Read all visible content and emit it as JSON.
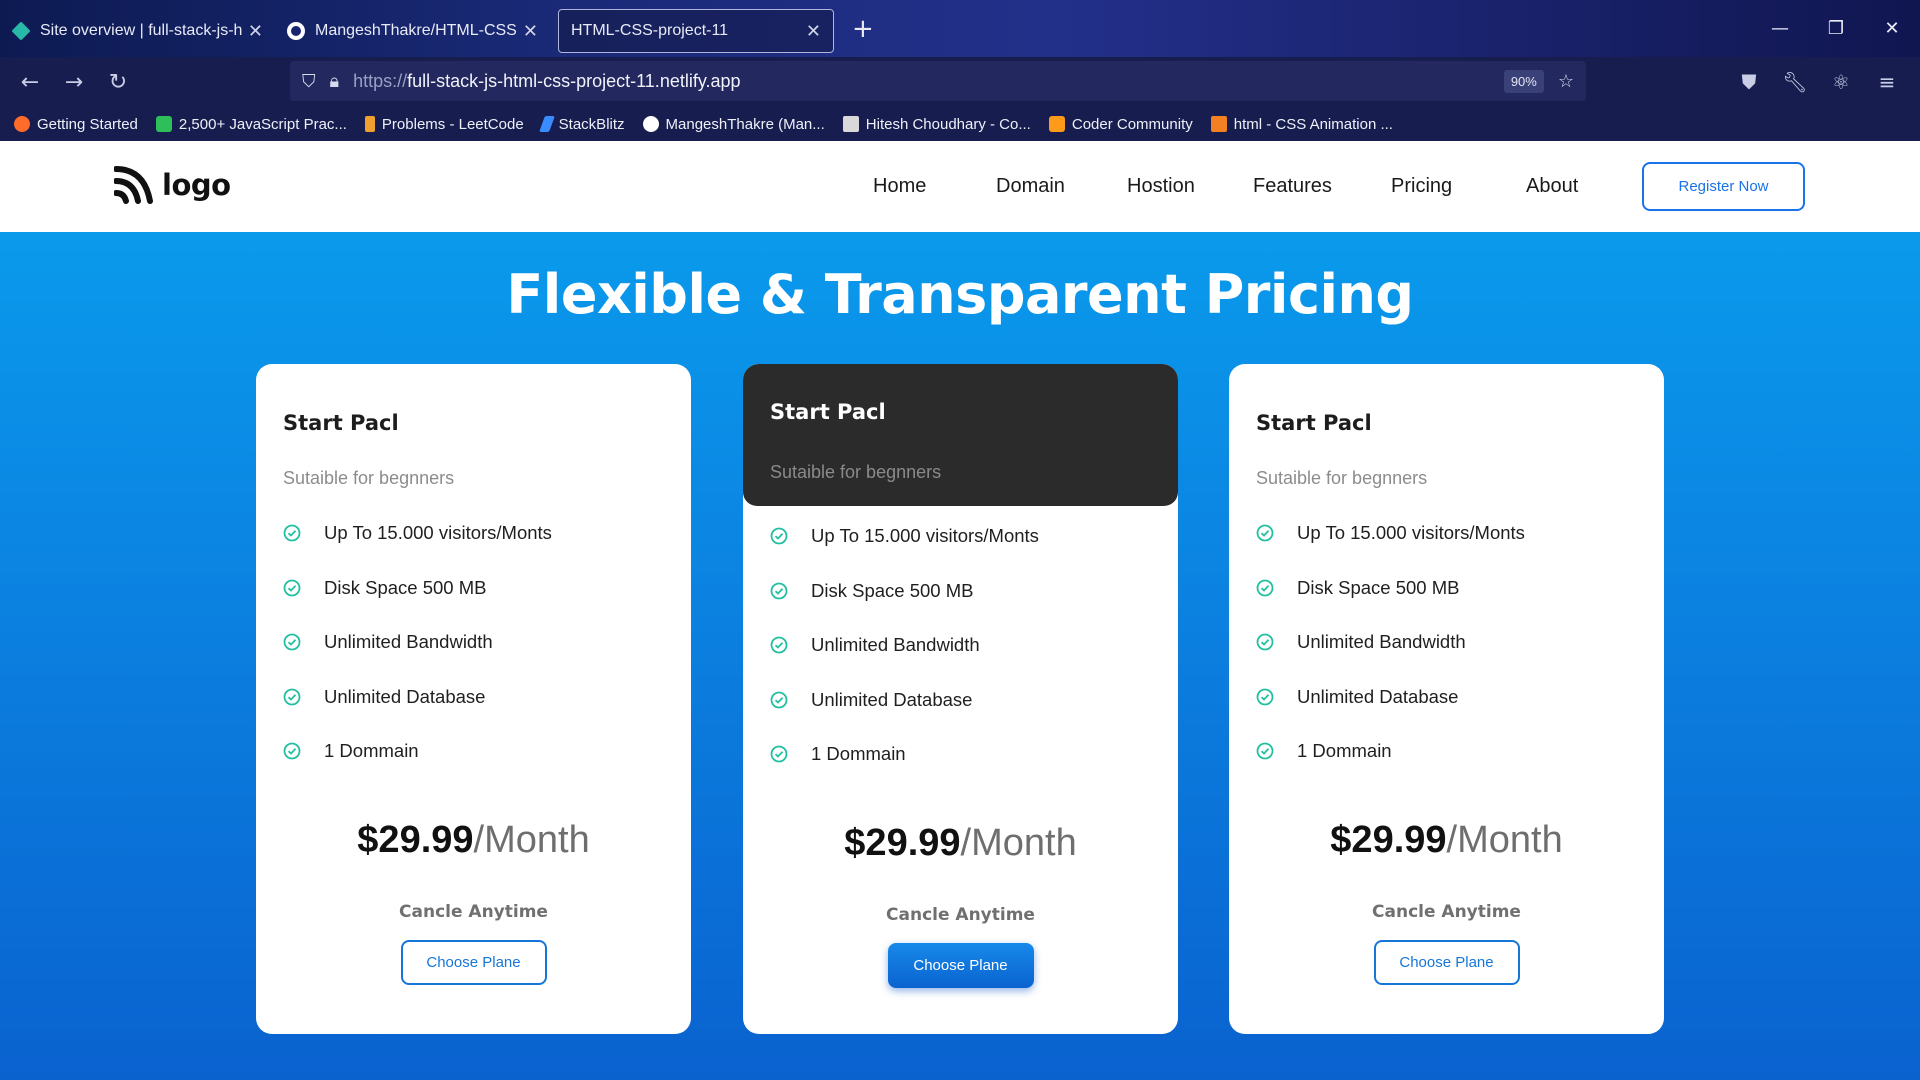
{
  "browser": {
    "tabs": [
      {
        "title": "Site overview | full-stack-js-html",
        "icon": "netlify-icon",
        "active": false
      },
      {
        "title": "MangeshThakre/HTML-CSS-Pro",
        "icon": "github-icon",
        "active": false
      },
      {
        "title": "HTML-CSS-project-11",
        "icon": "",
        "active": true
      }
    ],
    "new_tab_label": "+",
    "url_scheme": "https://",
    "url_host": "full-stack-js-html-css-project-11.netlify.app",
    "zoom": "90%",
    "bookmarks": [
      {
        "label": "Getting Started",
        "color": "#ff6b2b"
      },
      {
        "label": "2,500+ JavaScript Prac...",
        "color": "#2fbf5a"
      },
      {
        "label": "Problems - LeetCode",
        "color": "#f0a030"
      },
      {
        "label": "StackBlitz",
        "color": "#3a8bff"
      },
      {
        "label": "MangeshThakre (Man...",
        "color": "#ffffff"
      },
      {
        "label": "Hitesh Choudhary - Co...",
        "color": "#d9d9d9"
      },
      {
        "label": "Coder Community",
        "color": "#ff9a1a"
      },
      {
        "label": "html - CSS Animation ...",
        "color": "#f48024"
      }
    ]
  },
  "site": {
    "logo_text": "logo",
    "menu": [
      "Home",
      "Domain",
      "Hostion",
      "Features",
      "Pricing",
      "About"
    ],
    "register_label": "Register Now",
    "title": "Flexible & Transparent Pricing",
    "plans": [
      {
        "name": "Start Pacl",
        "subtitle": "Sutaible for begnners",
        "features": [
          "Up To 15.000 visitors/Monts",
          "Disk Space 500 MB",
          "Unlimited Bandwidth",
          "Unlimited Database",
          "1 Dommain"
        ],
        "price": "$29.99",
        "period": "/Month",
        "cancel": "Cancle Anytime",
        "button": "Choose Plane"
      },
      {
        "name": "Start Pacl",
        "subtitle": "Sutaible for begnners",
        "features": [
          "Up To 15.000 visitors/Monts",
          "Disk Space 500 MB",
          "Unlimited Bandwidth",
          "Unlimited Database",
          "1 Dommain"
        ],
        "price": "$29.99",
        "period": "/Month",
        "cancel": "Cancle Anytime",
        "button": "Choose Plane"
      },
      {
        "name": "Start Pacl",
        "subtitle": "Sutaible for begnners",
        "features": [
          "Up To 15.000 visitors/Monts",
          "Disk Space 500 MB",
          "Unlimited Bandwidth",
          "Unlimited Database",
          "1 Dommain"
        ],
        "price": "$29.99",
        "period": "/Month",
        "cancel": "Cancle Anytime",
        "button": "Choose Plane"
      }
    ]
  },
  "colors": {
    "accent": "#1a73e8",
    "check": "#22c0a0",
    "featured_head": "#2b2b2b"
  }
}
